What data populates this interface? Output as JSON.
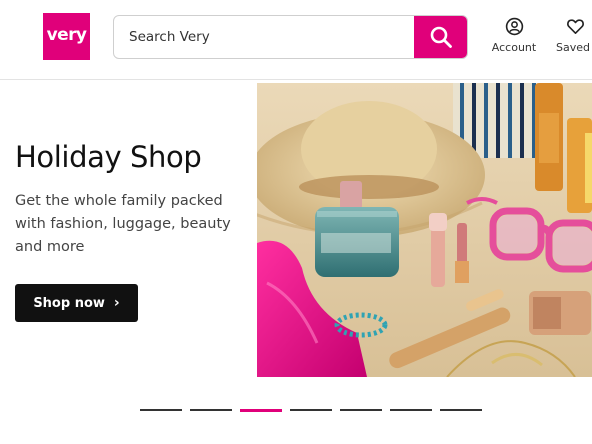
{
  "header": {
    "logo_text": "very",
    "search": {
      "placeholder": "Search Very",
      "value": ""
    },
    "search_button_icon": "search-icon",
    "nav": [
      {
        "label": "Account",
        "icon": "account-icon"
      },
      {
        "label": "Saved",
        "icon": "heart-icon"
      }
    ]
  },
  "hero": {
    "title": "Holiday Shop",
    "subtitle": "Get the whole family packed with fashion, luggage, beauty and more",
    "cta_label": "Shop now",
    "cta_icon": "chevron-right-icon"
  },
  "carousel": {
    "count": 7,
    "active_index": 2
  },
  "colors": {
    "brand": "#e0007a",
    "cta_bg": "#111111",
    "text": "#222222"
  }
}
